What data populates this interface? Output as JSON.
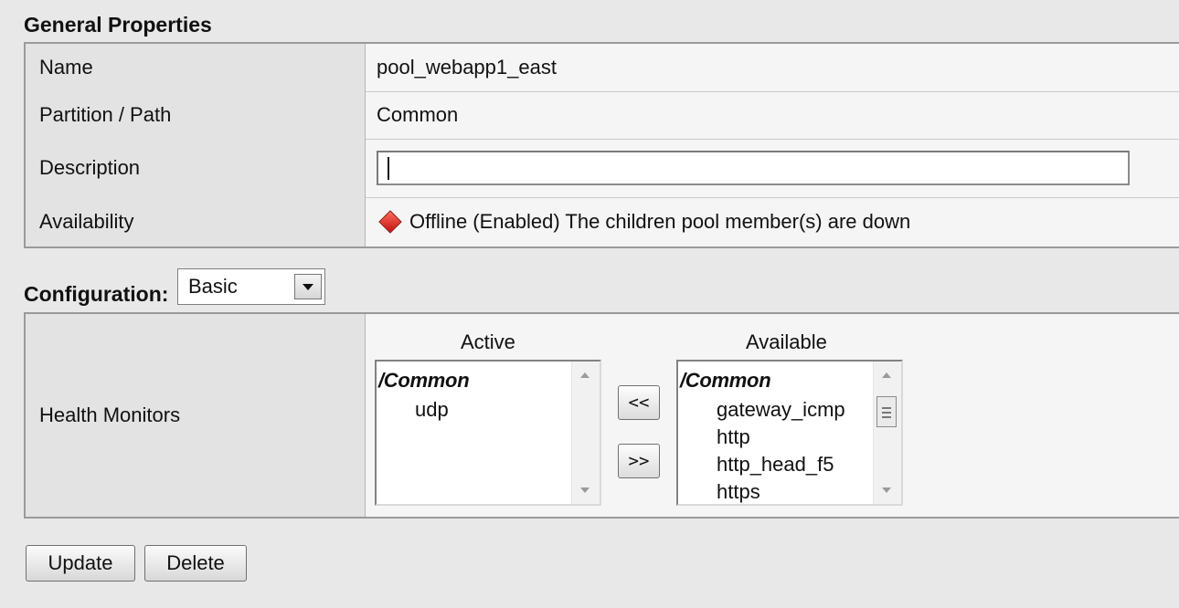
{
  "general": {
    "title": "General Properties",
    "rows": [
      {
        "label": "Name",
        "value": "pool_webapp1_east"
      },
      {
        "label": "Partition / Path",
        "value": "Common"
      },
      {
        "label": "Description",
        "value": ""
      },
      {
        "label": "Availability",
        "value": "Offline (Enabled) The children pool member(s) are down"
      }
    ],
    "status_icon": "red-diamond-icon",
    "status_color": "#d0190f"
  },
  "configuration": {
    "label": "Configuration:",
    "selected": "Basic"
  },
  "health_monitors": {
    "label": "Health Monitors",
    "active_title": "Active",
    "available_title": "Available",
    "active_group": "/Common",
    "active_items": [
      "udp"
    ],
    "available_group": "/Common",
    "available_items": [
      "gateway_icmp",
      "http",
      "http_head_f5",
      "https"
    ],
    "move_left_label": "<<",
    "move_right_label": ">>"
  },
  "buttons": {
    "update": "Update",
    "delete": "Delete"
  }
}
